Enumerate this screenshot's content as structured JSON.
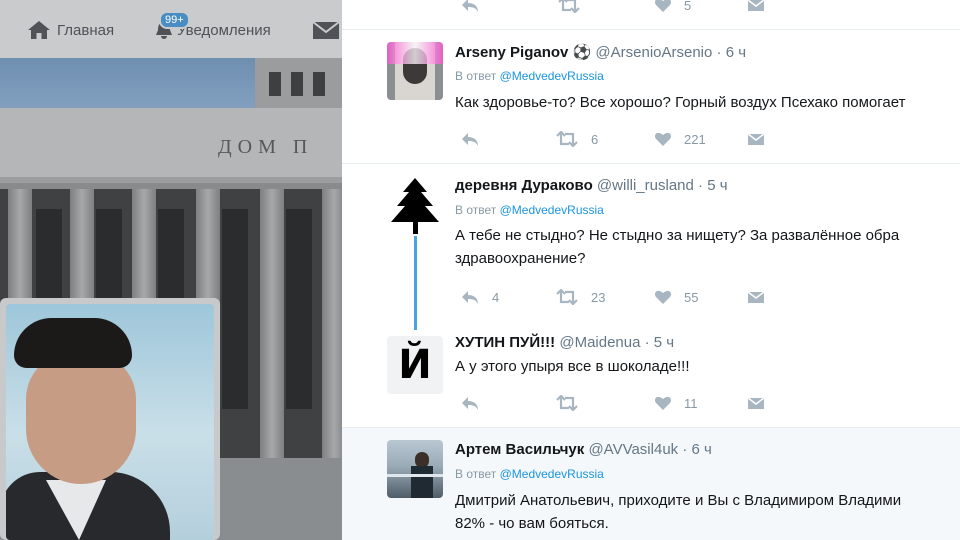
{
  "nav": {
    "home_label": "Главная",
    "notifications_label": "Уведомления",
    "notifications_badge": "99+"
  },
  "background": {
    "building_inscription": "ДОМ П"
  },
  "top_row": {
    "likes": "5"
  },
  "tweets": [
    {
      "name": "Arseny Piganov",
      "name_emoji": "⚽",
      "handle": "@ArsenioArsenio",
      "time": "6 ч",
      "reply_prefix": "В ответ",
      "reply_to": "@MedvedevRussia",
      "text_lines": [
        "Как здоровье-то? Все хорошо? Горный воздух Псехако помогает"
      ],
      "replies": "",
      "retweets": "6",
      "likes": "221"
    },
    {
      "name": "деревня Дураково",
      "handle": "@willi_rusland",
      "time": "5 ч",
      "reply_prefix": "В ответ",
      "reply_to": "@MedvedevRussia",
      "text_lines": [
        "А тебе не стыдно? Не стыдно за нищету? За развалённое обра",
        "здравоохранение?"
      ],
      "replies": "4",
      "retweets": "23",
      "likes": "55"
    },
    {
      "name": "ХУТИН ПУЙ!!!",
      "handle": "@Maidenua",
      "time": "5 ч",
      "avatar_letter": "Й",
      "text_lines": [
        "А у этого упыря все в шоколаде!!!"
      ],
      "replies": "",
      "retweets": "",
      "likes": "11"
    },
    {
      "name": "Артем Васильчук",
      "handle": "@AVVasil4uk",
      "time": "6 ч",
      "reply_prefix": "В ответ",
      "reply_to": "@MedvedevRussia",
      "text_lines": [
        "Дмитрий Анатольевич, приходите и Вы с Владимиром Владими",
        "82% - чо вам бояться."
      ]
    }
  ],
  "colors": {
    "link": "#1b95e0",
    "thread_line": "#4aa3df",
    "meta_gray": "#8899a6"
  }
}
